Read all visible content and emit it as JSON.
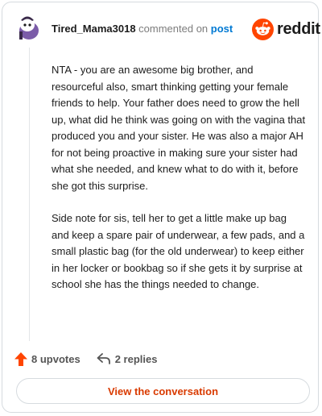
{
  "comment": {
    "username": "Tired_Mama3018",
    "commented_text": "commented on",
    "post_link": "post",
    "paragraphs": [
      "NTA - you are an awesome big brother, and resourceful also, smart thinking getting your female friends to help. Your father does need to grow the hell up, what did he think was going on with the vagina that produced you and your sister. He was also a major AH for not being proactive in making sure your sister had what she needed, and knew what to do with it, before she got this surprise.",
      "Side note for sis, tell her to get a little make up bag and keep a spare pair of underwear, a few pads, and a small plastic bag (for the old underwear) to keep either in her locker or bookbag so if she gets it by surprise at school she has the things needed to change."
    ],
    "upvotes": "8 upvotes",
    "replies": "2 replies"
  },
  "brand": {
    "name": "reddit",
    "color": "#ff4500"
  },
  "button": {
    "view_conversation": "View the conversation"
  },
  "icons": {
    "avatar": "snoo-avatar-icon",
    "logo": "reddit-logo-icon",
    "upvote": "upvote-arrow-icon",
    "reply": "reply-arrow-icon"
  },
  "colors": {
    "upvote": "#ff4500",
    "link": "#0079d3",
    "button_text": "#d93a00"
  }
}
